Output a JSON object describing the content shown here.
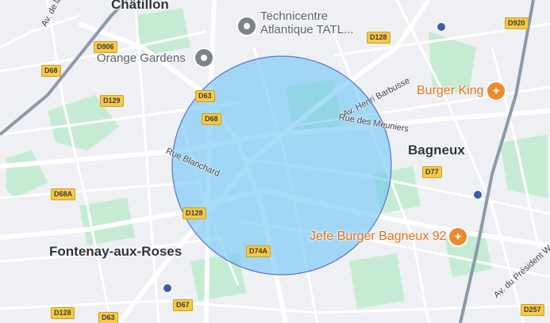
{
  "map": {
    "type": "street-map",
    "overlay": {
      "shape": "circle",
      "fill_color": "#6ec6f5",
      "stroke_color": "#5a6fd6",
      "opacity": 0.6
    },
    "places": {
      "chatillon": "Châtillon",
      "bagneux": "Bagneux",
      "fontenay": "Fontenay-aux-Roses"
    },
    "pois": {
      "technicentre_line1": "Technicentre",
      "technicentre_line2": "Atlantique TATL...",
      "orange_gardens": "Orange Gardens",
      "burger_king": "Burger King",
      "jefe_burger": "Jefe Burger Bagneux 92"
    },
    "streets": {
      "av_de_la_paix": "Av. de la Paix",
      "rue_blanchard": "Rue Blanchard",
      "av_henri_barbusse": "Av. Henri Barbusse",
      "rue_des_meuniers": "Rue des Meuniers",
      "av_du_president": "Av. du Président W..."
    },
    "road_shields": {
      "d906": "D906",
      "d68_a": "D68",
      "d129": "D129",
      "d63_a": "D63",
      "d68_b": "D68",
      "d128_a": "D128",
      "d920": "D920",
      "d77": "D77",
      "d68a": "D68A",
      "d128_b": "D128",
      "d74a": "D74A",
      "d128_c": "D128",
      "d63_b": "D63",
      "d67": "D67",
      "d257": "D257"
    },
    "colors": {
      "land": "#eef0f3",
      "road": "#ffffff",
      "park": "#c6ebd3",
      "rail": "#8a9aaa",
      "poi_orange": "#ee8a2e",
      "poi_gray": "#7d8388"
    }
  }
}
